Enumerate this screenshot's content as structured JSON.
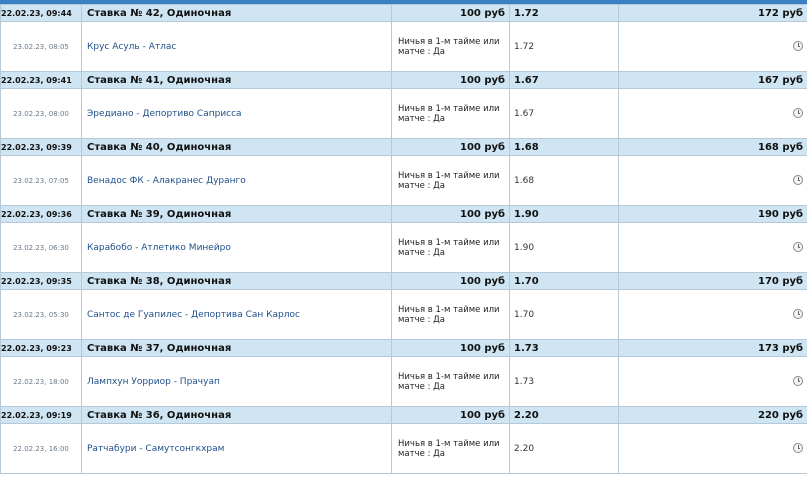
{
  "bets": [
    {
      "placed": "22.02.23, 09:44",
      "title": "Ставка № 42, Одиночная",
      "amount": "100 руб",
      "coef": "1.72",
      "payout": "172 руб",
      "event_date": "23.02.23, 08:05",
      "event": "Крус Асуль - Атлас",
      "market": "Ничья в 1-м тайме или матче : Да",
      "odds": "1.72",
      "status_icon": "clock-icon"
    },
    {
      "placed": "22.02.23, 09:41",
      "title": "Ставка № 41, Одиночная",
      "amount": "100 руб",
      "coef": "1.67",
      "payout": "167 руб",
      "event_date": "23.02.23, 08:00",
      "event": "Эредиано - Депортиво Саприсса",
      "market": "Ничья в 1-м тайме или матче : Да",
      "odds": "1.67",
      "status_icon": "clock-icon"
    },
    {
      "placed": "22.02.23, 09:39",
      "title": "Ставка № 40, Одиночная",
      "amount": "100 руб",
      "coef": "1.68",
      "payout": "168 руб",
      "event_date": "23.02.23, 07:05",
      "event": "Венадос ФК - Алакранес Дуранго",
      "market": "Ничья в 1-м тайме или матче : Да",
      "odds": "1.68",
      "status_icon": "clock-icon"
    },
    {
      "placed": "22.02.23, 09:36",
      "title": "Ставка № 39, Одиночная",
      "amount": "100 руб",
      "coef": "1.90",
      "payout": "190 руб",
      "event_date": "23.02.23, 06:30",
      "event": "Карабобо - Атлетико Минейро",
      "market": "Ничья в 1-м тайме или матче : Да",
      "odds": "1.90",
      "status_icon": "clock-icon"
    },
    {
      "placed": "22.02.23, 09:35",
      "title": "Ставка № 38, Одиночная",
      "amount": "100 руб",
      "coef": "1.70",
      "payout": "170 руб",
      "event_date": "23.02.23, 05:30",
      "event": "Сантос де Гуапилес - Депортива Сан Карлос",
      "market": "Ничья в 1-м тайме или матче : Да",
      "odds": "1.70",
      "status_icon": "clock-icon"
    },
    {
      "placed": "22.02.23, 09:23",
      "title": "Ставка № 37, Одиночная",
      "amount": "100 руб",
      "coef": "1.73",
      "payout": "173 руб",
      "event_date": "22.02.23, 18:00",
      "event": "Лампхун Уорриор - Прачуап",
      "market": "Ничья в 1-м тайме или матче : Да",
      "odds": "1.73",
      "status_icon": "clock-icon"
    },
    {
      "placed": "22.02.23, 09:19",
      "title": "Ставка № 36, Одиночная",
      "amount": "100 руб",
      "coef": "2.20",
      "payout": "220 руб",
      "event_date": "22.02.23, 16:00",
      "event": "Ратчабури - Самутсонгкхрам",
      "market": "Ничья в 1-м тайме или матче : Да",
      "odds": "2.20",
      "status_icon": "clock-icon"
    }
  ]
}
